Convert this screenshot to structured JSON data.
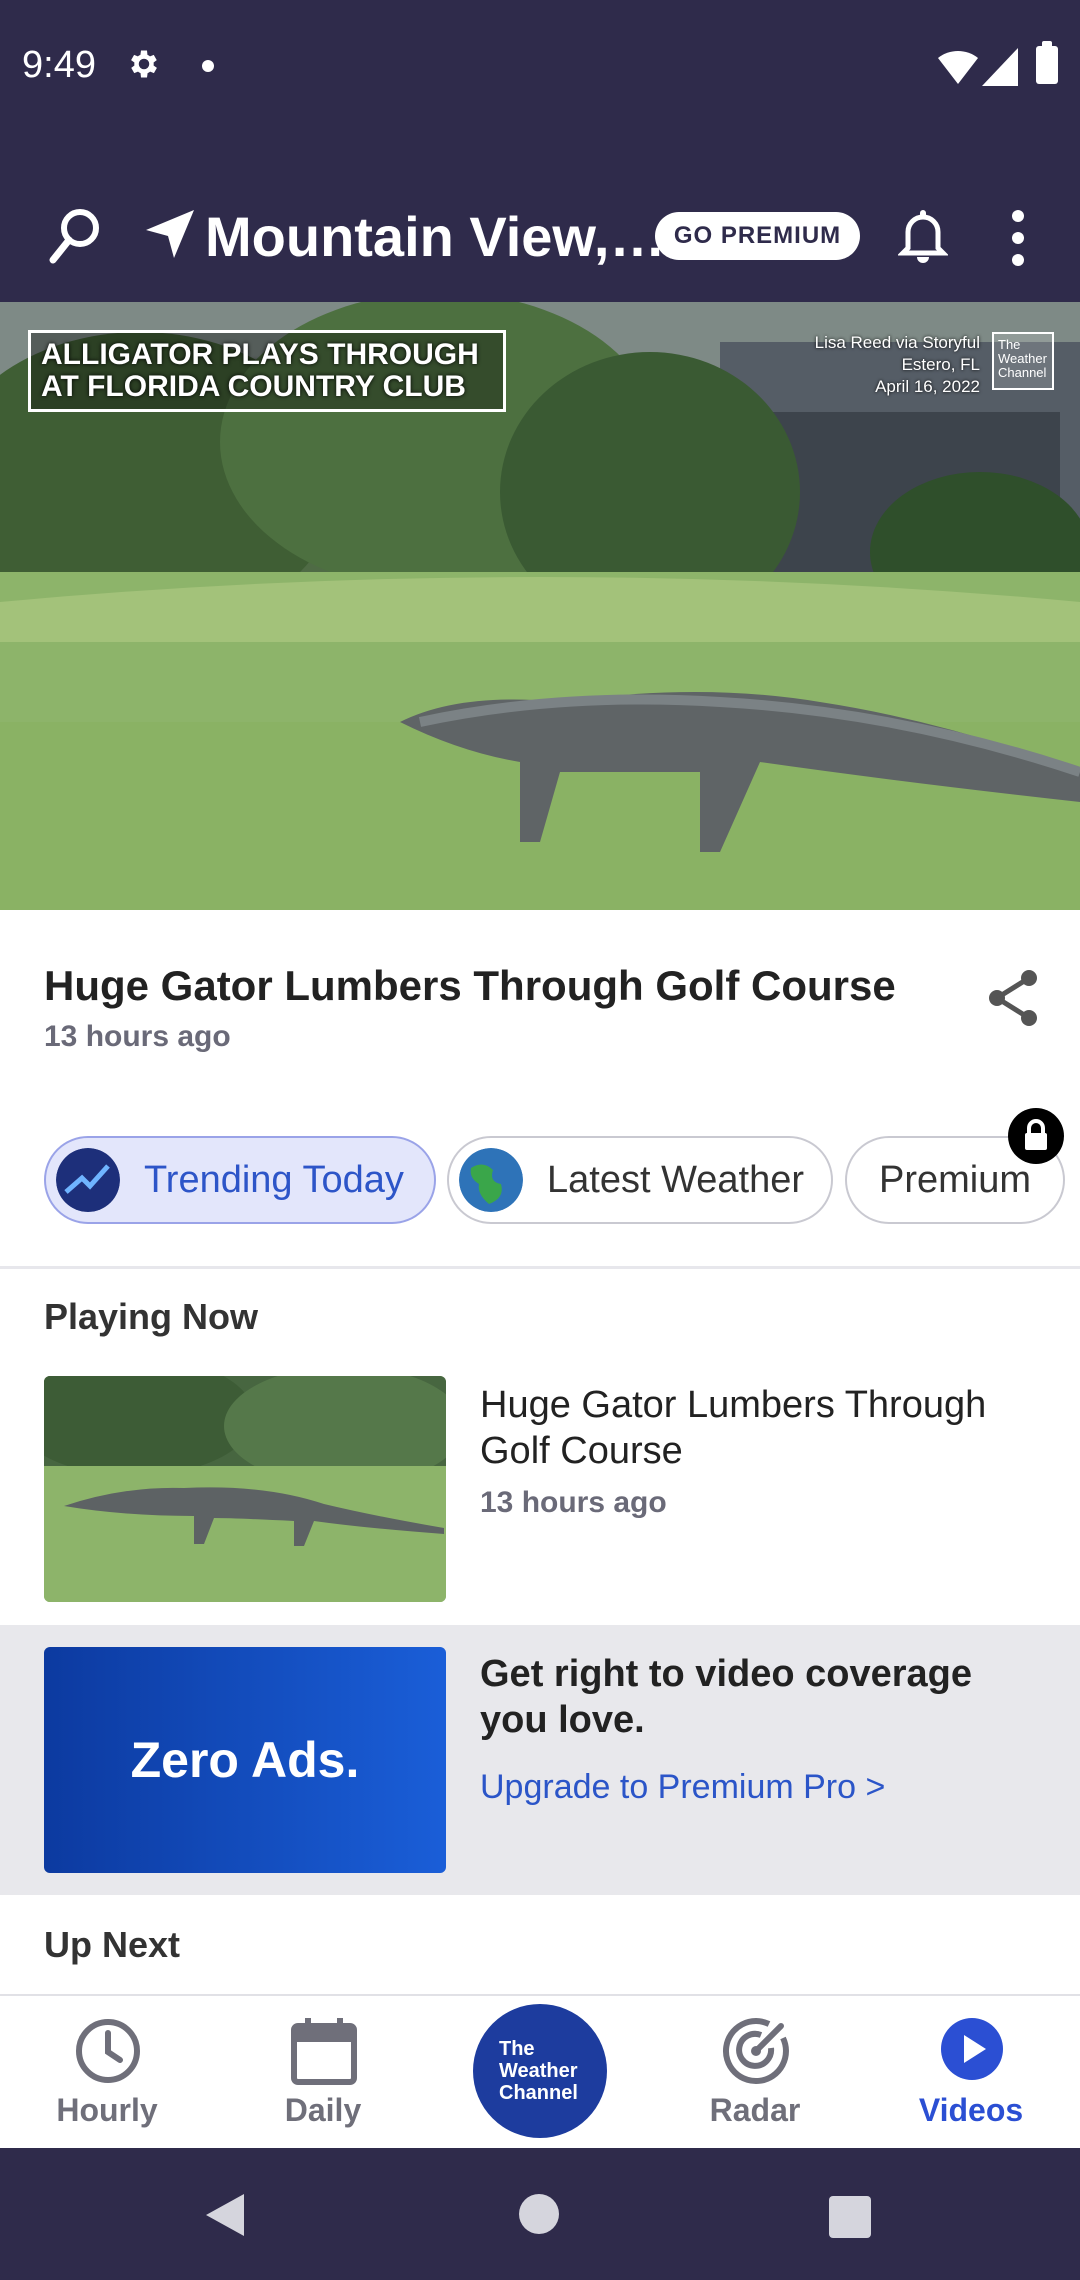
{
  "status_bar": {
    "time": "9:49"
  },
  "app_bar": {
    "location": "Mountain View,…",
    "premium_label": "GO PREMIUM"
  },
  "video": {
    "headline": "ALLIGATOR PLAYS THROUGH AT FLORIDA COUNTRY CLUB",
    "credit_lines": [
      "Lisa Reed via Storyful",
      "Estero, FL",
      "April 16, 2022"
    ],
    "logo_text": "The Weather Channel"
  },
  "article": {
    "title": "Huge Gator Lumbers Through Golf Course",
    "time": "13 hours ago"
  },
  "chips": [
    {
      "label": "Trending Today",
      "icon": "trending-icon",
      "active": true
    },
    {
      "label": "Latest Weather",
      "icon": "globe-icon",
      "active": false
    },
    {
      "label": "Premium",
      "icon": "lock-icon",
      "active": false
    }
  ],
  "playing_now": {
    "section_title": "Playing Now",
    "title": "Huge Gator Lumbers Through Golf Course",
    "time": "13 hours ago"
  },
  "promo": {
    "badge": "Zero Ads.",
    "text": "Get right to video coverage you love.",
    "link": "Upgrade to Premium Pro >"
  },
  "up_next": {
    "section_title": "Up Next"
  },
  "bottom_nav": {
    "items": [
      {
        "label": "Hourly",
        "icon": "clock-icon"
      },
      {
        "label": "Daily",
        "icon": "calendar-icon"
      },
      {
        "label": "Radar",
        "icon": "radar-icon"
      },
      {
        "label": "Videos",
        "icon": "play-icon",
        "active": true
      }
    ],
    "center_logo": "The Weather Channel"
  },
  "colors": {
    "brand_dark": "#2f2b4b",
    "accent_blue": "#2b4fd3",
    "promo_blue": "#0c3aa0"
  }
}
